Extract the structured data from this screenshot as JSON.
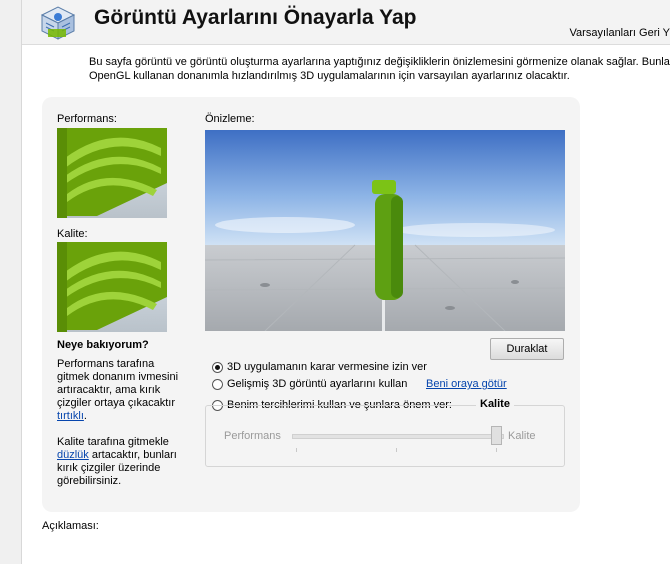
{
  "header": {
    "title": "Görüntü Ayarlarını Önayarla Yap",
    "restore_defaults": "Varsayılanları Geri Y"
  },
  "description": {
    "line1": "Bu sayfa görüntü ve görüntü oluşturma ayarlarına yaptığınız değişikliklerin önizlemesini görmenize olanak sağlar. Bunlar Direc",
    "line2": "OpenGL kullanan donanımla hızlandırılmış 3D uygulamalarının için varsayılan ayarlarınız olacaktır."
  },
  "panel": {
    "performance_label": "Performans:",
    "quality_label": "Kalite:",
    "preview_label": "Önizleme:",
    "what_heading": "Neye bakıyorum?",
    "perf_text_1": "Performans tarafına gitmek donanım ivmesini artıracaktır, ama kırık çizgiler ortaya çıkacaktır ",
    "perf_link": "tırtıklı",
    "perf_text_2": ".",
    "qual_text_1": "Kalite tarafına  gitmekle ",
    "qual_link": "düzlük",
    "qual_text_2": " artacaktır, bunları kırık çizgiler üzerinde görebilirsiniz.",
    "pause_button": "Duraklat",
    "radio_options": [
      {
        "label": "3D uygulamanın karar vermesine izin ver",
        "checked": true
      },
      {
        "label": "Gelişmiş 3D görüntü ayarlarını kullan",
        "checked": false,
        "link": "Beni oraya götür"
      },
      {
        "label": "Benim tercihlerimi kullan ve şunlara önem ver:",
        "checked": false
      }
    ],
    "slider": {
      "title": "Kalite",
      "left_label": "Performans",
      "right_label": "Kalite",
      "value_fraction": 1.0,
      "enabled": false
    }
  },
  "footer": {
    "description_label": "Açıklaması:"
  },
  "colors": {
    "accent_green": "#76b900",
    "link_blue": "#0645ad"
  }
}
